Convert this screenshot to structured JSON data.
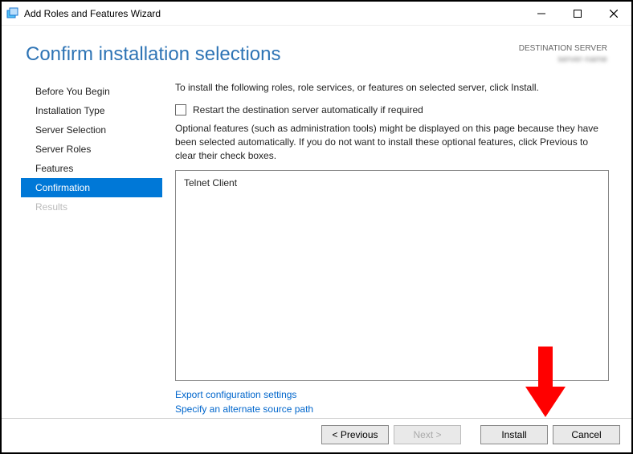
{
  "window": {
    "title": "Add Roles and Features Wizard"
  },
  "header": {
    "page_title": "Confirm installation selections",
    "dest_label": "DESTINATION SERVER",
    "dest_server": "server-name"
  },
  "sidebar": {
    "steps": [
      {
        "label": "Before You Begin",
        "active": false,
        "disabled": false
      },
      {
        "label": "Installation Type",
        "active": false,
        "disabled": false
      },
      {
        "label": "Server Selection",
        "active": false,
        "disabled": false
      },
      {
        "label": "Server Roles",
        "active": false,
        "disabled": false
      },
      {
        "label": "Features",
        "active": false,
        "disabled": false
      },
      {
        "label": "Confirmation",
        "active": true,
        "disabled": false
      },
      {
        "label": "Results",
        "active": false,
        "disabled": true
      }
    ]
  },
  "main": {
    "intro": "To install the following roles, role services, or features on selected server, click Install.",
    "restart_label": "Restart the destination server automatically if required",
    "restart_checked": false,
    "optional_text": "Optional features (such as administration tools) might be displayed on this page because they have been selected automatically. If you do not want to install these optional features, click Previous to clear their check boxes.",
    "selected_features": [
      "Telnet Client"
    ],
    "export_link": "Export configuration settings",
    "alt_path_link": "Specify an alternate source path"
  },
  "footer": {
    "previous": "< Previous",
    "next": "Next >",
    "install": "Install",
    "cancel": "Cancel"
  }
}
